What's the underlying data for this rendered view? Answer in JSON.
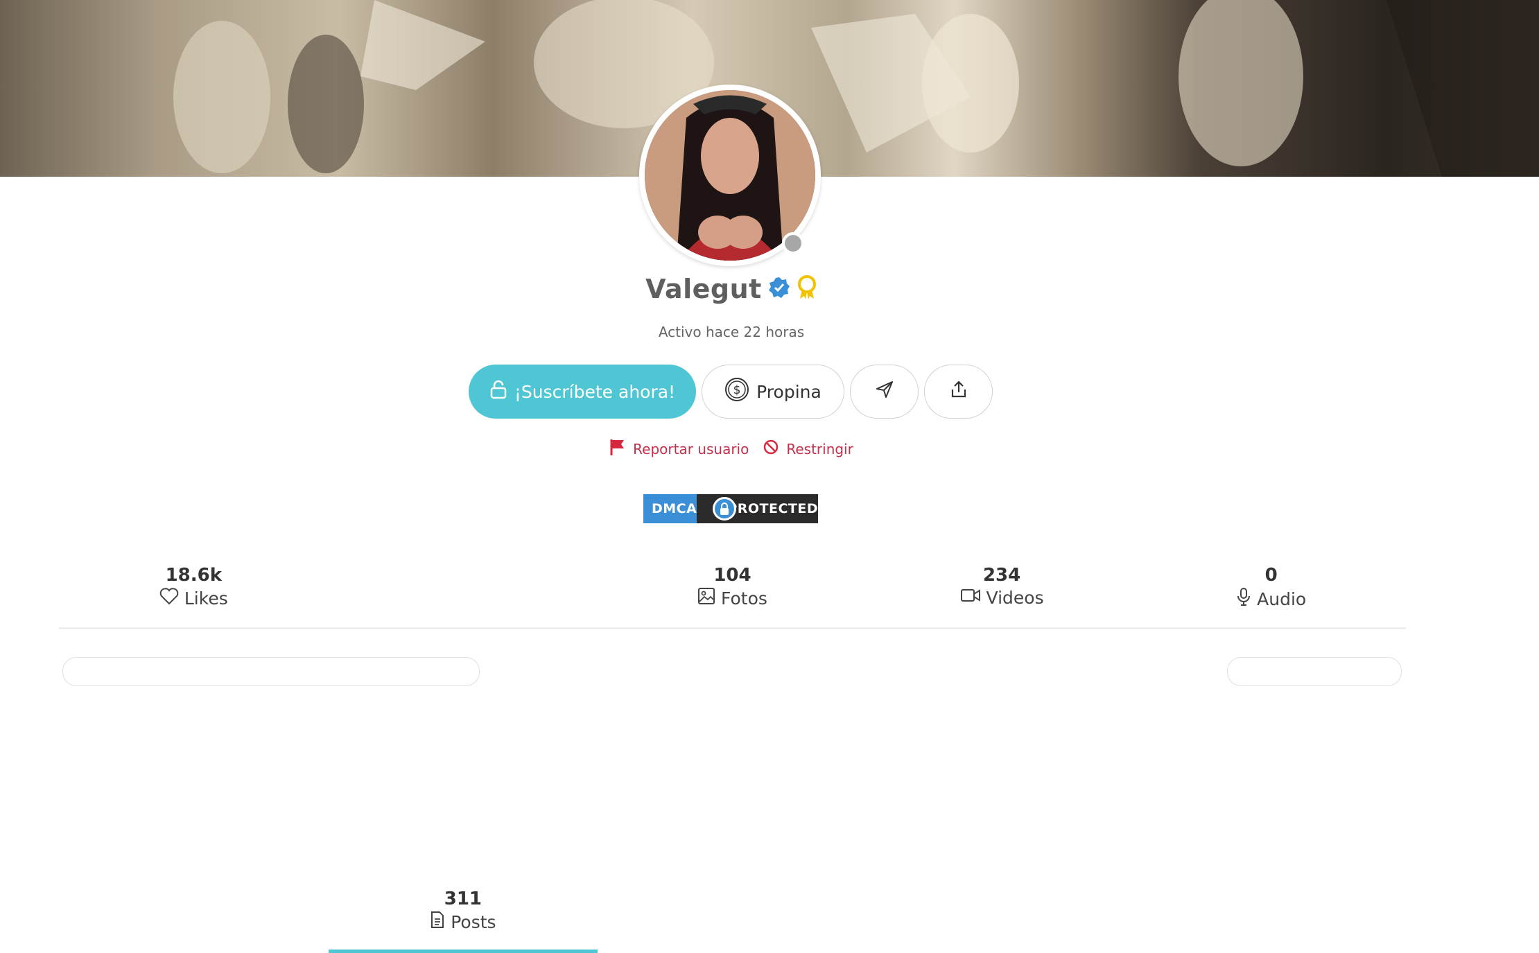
{
  "profile": {
    "name": "Valegut",
    "active_status": "Activo hace 22 horas",
    "online": false
  },
  "actions": {
    "subscribe_label": "¡Suscríbete ahora!",
    "tip_label": "Propina"
  },
  "links": {
    "report_label": "Reportar usuario",
    "restrict_label": "Restringir"
  },
  "dmca": {
    "left_text": "DMCA",
    "right_text": "PROTECTED"
  },
  "tabs": [
    {
      "count": "18.6k",
      "label": "Likes",
      "icon": "heart-icon"
    },
    {
      "count": "311",
      "label": "Posts",
      "icon": "document-icon",
      "active": true
    },
    {
      "count": "104",
      "label": "Fotos",
      "icon": "image-icon"
    },
    {
      "count": "234",
      "label": "Videos",
      "icon": "video-icon"
    },
    {
      "count": "0",
      "label": "Audio",
      "icon": "microphone-icon"
    }
  ],
  "colors": {
    "accent": "#4fc6d3",
    "danger": "#c2304a",
    "verified": "#3a8fd6",
    "badge": "#f2c200"
  }
}
